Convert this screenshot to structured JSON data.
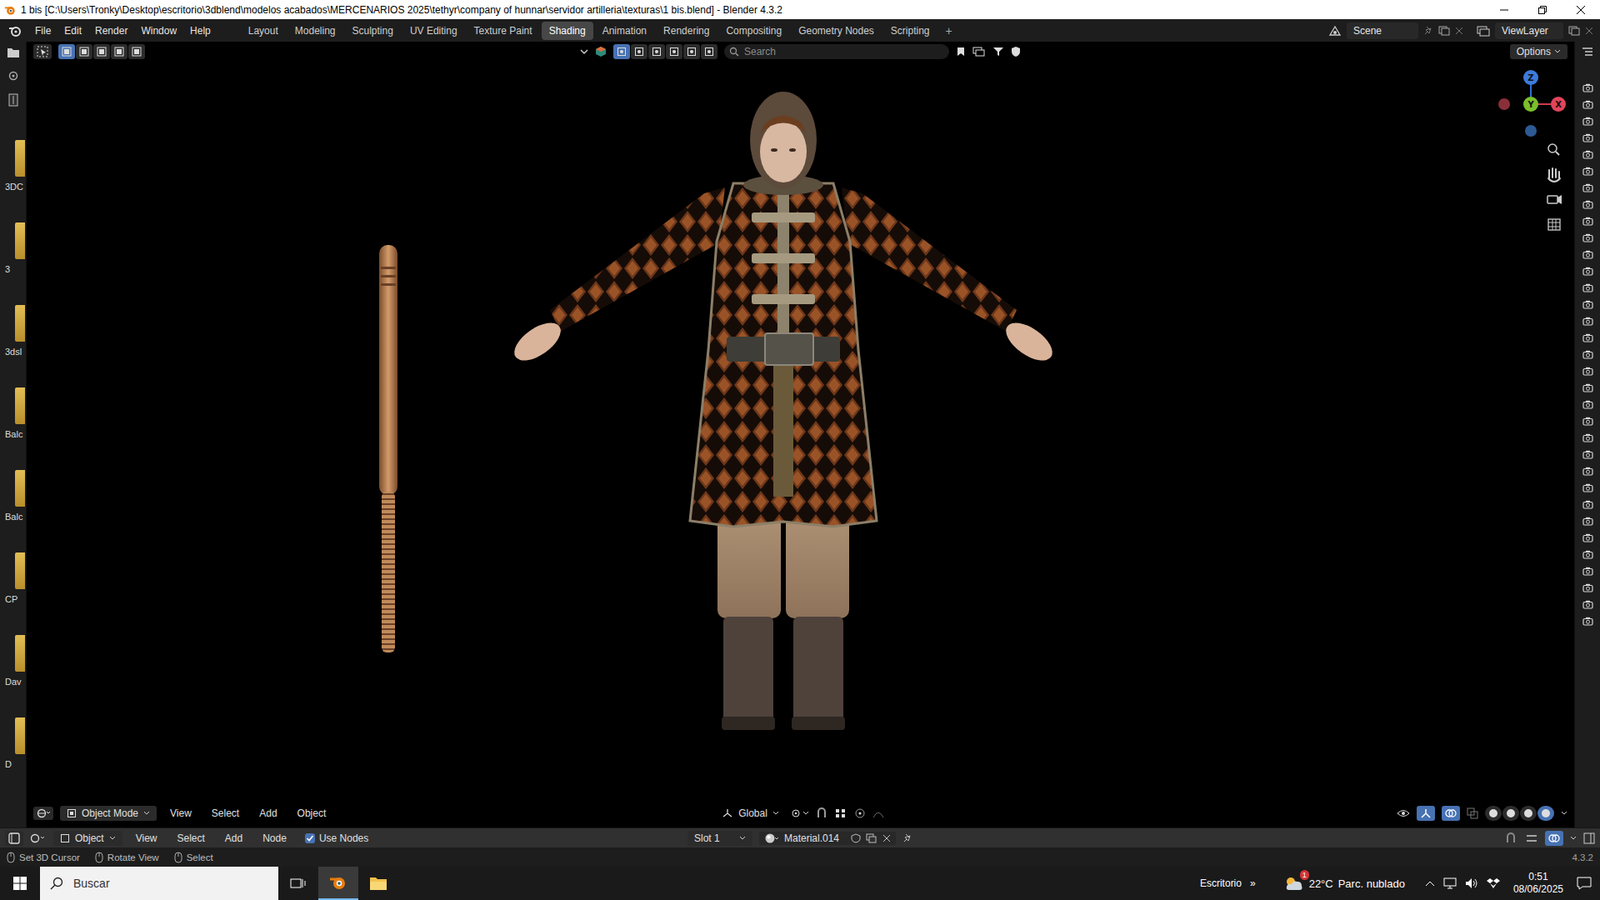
{
  "window": {
    "title": "1 bis [C:\\Users\\Tronky\\Desktop\\escritorio\\3dblend\\modelos acabados\\MERCENARIOS 2025\\tethyr\\company of hunnar\\servidor artilleria\\texturas\\1 bis.blend] - Blender 4.3.2"
  },
  "menu": [
    "File",
    "Edit",
    "Render",
    "Window",
    "Help"
  ],
  "workspaces": [
    {
      "label": "Layout",
      "selected": false
    },
    {
      "label": "Modeling",
      "selected": false
    },
    {
      "label": "Sculpting",
      "selected": false
    },
    {
      "label": "UV Editing",
      "selected": false
    },
    {
      "label": "Texture Paint",
      "selected": false
    },
    {
      "label": "Shading",
      "selected": true
    },
    {
      "label": "Animation",
      "selected": false
    },
    {
      "label": "Rendering",
      "selected": false
    },
    {
      "label": "Compositing",
      "selected": false
    },
    {
      "label": "Geometry Nodes",
      "selected": false
    },
    {
      "label": "Scripting",
      "selected": false
    }
  ],
  "add_workspace": "+",
  "scene": "Scene",
  "view_layer": "ViewLayer",
  "asset_strip": [
    "3DC",
    "3",
    "3dsl",
    "Balc",
    "Balc",
    "CP",
    "Dav",
    "D"
  ],
  "viewport": {
    "select_modes": [
      {
        "selected": true
      },
      {
        "selected": false
      },
      {
        "selected": false
      },
      {
        "selected": false
      },
      {
        "selected": false
      }
    ],
    "view_modes": [
      {
        "selected": true
      },
      {
        "selected": false
      },
      {
        "selected": false
      },
      {
        "selected": false
      },
      {
        "selected": false
      },
      {
        "selected": false
      }
    ],
    "search_placeholder": "Search",
    "options": "Options",
    "gizmo": [
      "Z",
      "Y",
      "X"
    ],
    "mode": "Object Mode",
    "menus": [
      "View",
      "Select",
      "Add",
      "Object"
    ],
    "orientation": "Global",
    "shading_modes": [
      {
        "selected": false
      },
      {
        "selected": false
      },
      {
        "selected": false
      },
      {
        "selected": true
      }
    ]
  },
  "shader_editor": {
    "mode": "Object",
    "menus": [
      "View",
      "Select",
      "Add",
      "Node"
    ],
    "use_nodes": {
      "label": "Use Nodes",
      "checked": true
    },
    "slot": "Slot 1",
    "material": "Material.014"
  },
  "status_bar": {
    "hints": [
      "Set 3D Cursor",
      "Rotate View",
      "Select"
    ],
    "version": "4.3.2"
  },
  "outliner_strip": [
    {
      "render": true
    },
    {
      "render": true
    },
    {
      "render": true
    },
    {
      "render": true
    },
    {
      "render": true
    },
    {
      "render": true
    },
    {
      "render": true
    },
    {
      "render": true
    },
    {
      "render": true
    },
    {
      "render": true
    },
    {
      "render": true
    },
    {
      "render": true
    },
    {
      "render": true
    },
    {
      "render": true
    },
    {
      "render": true
    },
    {
      "render": true
    },
    {
      "render": true
    },
    {
      "render": true
    },
    {
      "render": true
    },
    {
      "render": true
    },
    {
      "render": true
    },
    {
      "render": true
    },
    {
      "render": true
    },
    {
      "render": true
    },
    {
      "render": true
    },
    {
      "render": true
    },
    {
      "render": true
    },
    {
      "render": true
    },
    {
      "render": true
    },
    {
      "render": true
    },
    {
      "render": true
    },
    {
      "render": true
    },
    {
      "render": true
    }
  ],
  "taskbar": {
    "search_placeholder": "Buscar",
    "desktop": "Escritorio",
    "chevron": "»",
    "temperature": "22°C",
    "weather": "Parc. nublado",
    "weather_badge": "1",
    "time": "0:51",
    "date": "08/06/2025"
  }
}
